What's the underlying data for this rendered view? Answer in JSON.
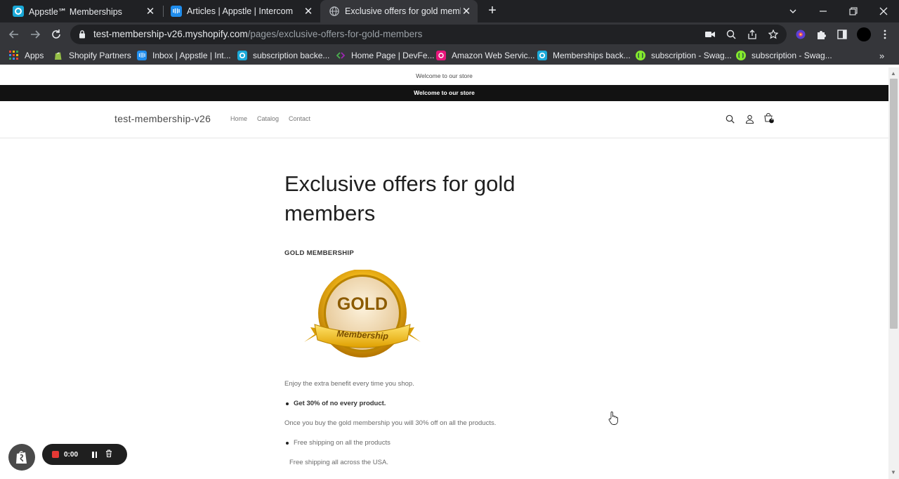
{
  "browser": {
    "tabs": [
      {
        "label": "Appstle℠ Memberships",
        "icon": "appstle-icon",
        "active": false
      },
      {
        "label": "Articles | Appstle | Intercom",
        "icon": "intercom-icon",
        "active": false
      },
      {
        "label": "Exclusive offers for gold member",
        "icon": "globe-icon",
        "active": true
      }
    ],
    "url_host": "test-membership-v26.myshopify.com",
    "url_path": "/pages/exclusive-offers-for-gold-members",
    "bookmarks": [
      {
        "label": "Apps",
        "icon": "apps-grid-icon"
      },
      {
        "label": "Shopify Partners",
        "icon": "shopify-icon"
      },
      {
        "label": "Inbox | Appstle | Int...",
        "icon": "intercom-icon"
      },
      {
        "label": "subscription backe...",
        "icon": "appstle-icon"
      },
      {
        "label": "Home Page | DevFe...",
        "icon": "devfe-icon"
      },
      {
        "label": "Amazon Web Servic...",
        "icon": "aws-icon"
      },
      {
        "label": "Memberships back...",
        "icon": "appstle-icon"
      },
      {
        "label": "subscription - Swag...",
        "icon": "swagger-icon"
      },
      {
        "label": "subscription - Swag...",
        "icon": "swagger-icon"
      }
    ],
    "colors": {
      "chrome_dark": "#202124",
      "chrome_mid": "#35363a"
    }
  },
  "store": {
    "announcement_top": "Welcome to our store",
    "announcement_bar": "Welcome to our store",
    "logo": "test-membership-v26",
    "nav": [
      "Home",
      "Catalog",
      "Contact"
    ],
    "cart_count": "1"
  },
  "page": {
    "title_line1": "Exclusive offers for gold",
    "title_line2": "members",
    "section_heading": "GOLD MEMBERSHIP",
    "badge_top": "GOLD",
    "badge_ribbon": "Membership",
    "para1": "Enjoy the extra benefit every time you shop.",
    "bullet1": "Get 30% of no every product.",
    "para2": "Once you buy the gold membership you will 30% off on all the products.",
    "bullet2": "Free shipping on all the products",
    "para3": "Free shipping all across the USA."
  },
  "recorder": {
    "time": "0:00"
  }
}
